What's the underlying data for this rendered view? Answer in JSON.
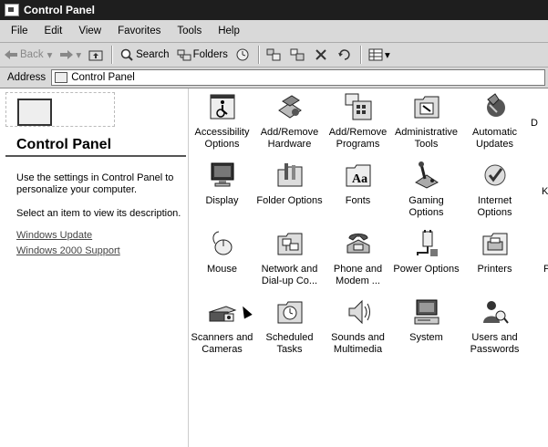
{
  "window": {
    "title": "Control Panel"
  },
  "menu": [
    "File",
    "Edit",
    "View",
    "Favorites",
    "Tools",
    "Help"
  ],
  "toolbar": {
    "back": "Back",
    "search": "Search",
    "folders": "Folders"
  },
  "address": {
    "label": "Address",
    "value": "Control Panel"
  },
  "left_pane": {
    "title": "Control Panel",
    "description": "Use the settings in Control Panel to personalize your computer.",
    "hint": "Select an item to view its description.",
    "links": [
      "Windows Update",
      "Windows 2000 Support"
    ]
  },
  "items": [
    {
      "label": "Accessibility\nOptions",
      "icon": "accessibility-icon"
    },
    {
      "label": "Add/Remove\nHardware",
      "icon": "add-hardware-icon"
    },
    {
      "label": "Add/Remove\nPrograms",
      "icon": "add-programs-icon"
    },
    {
      "label": "Administrative\nTools",
      "icon": "admin-tools-icon"
    },
    {
      "label": "Automatic\nUpdates",
      "icon": "auto-updates-icon"
    },
    {
      "label": "Display",
      "icon": "display-icon"
    },
    {
      "label": "Folder Options",
      "icon": "folder-options-icon"
    },
    {
      "label": "Fonts",
      "icon": "fonts-icon"
    },
    {
      "label": "Gaming\nOptions",
      "icon": "gaming-icon"
    },
    {
      "label": "Internet\nOptions",
      "icon": "internet-options-icon"
    },
    {
      "label": "Mouse",
      "icon": "mouse-icon"
    },
    {
      "label": "Network and\nDial-up Co...",
      "icon": "network-icon"
    },
    {
      "label": "Phone and\nModem ...",
      "icon": "phone-modem-icon"
    },
    {
      "label": "Power Options",
      "icon": "power-icon"
    },
    {
      "label": "Printers",
      "icon": "printer-icon"
    },
    {
      "label": "Scanners and\nCameras",
      "icon": "scanner-icon"
    },
    {
      "label": "Scheduled\nTasks",
      "icon": "scheduled-tasks-icon"
    },
    {
      "label": "Sounds and\nMultimedia",
      "icon": "sounds-icon"
    },
    {
      "label": "System",
      "icon": "system-icon"
    },
    {
      "label": "Users and\nPasswords",
      "icon": "users-icon"
    }
  ],
  "partial_labels": [
    "D",
    "K",
    "P"
  ]
}
